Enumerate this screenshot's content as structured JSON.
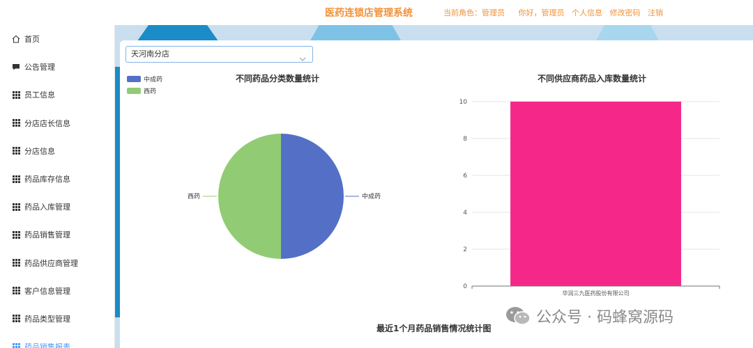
{
  "header": {
    "title": "医药连锁店管理系统",
    "role_label": "当前角色：",
    "role_value": "管理员",
    "greeting": "你好，管理员",
    "links": [
      "个人信息",
      "修改密码",
      "注销"
    ]
  },
  "sidebar": {
    "items": [
      {
        "label": "首页",
        "icon": "home-icon"
      },
      {
        "label": "公告管理",
        "icon": "message-icon"
      },
      {
        "label": "员工信息",
        "icon": "grid-icon"
      },
      {
        "label": "分店店长信息",
        "icon": "grid-icon"
      },
      {
        "label": "分店信息",
        "icon": "grid-icon"
      },
      {
        "label": "药品库存信息",
        "icon": "grid-icon"
      },
      {
        "label": "药品入库管理",
        "icon": "grid-icon"
      },
      {
        "label": "药品销售管理",
        "icon": "grid-icon"
      },
      {
        "label": "药品供应商管理",
        "icon": "grid-icon"
      },
      {
        "label": "客户信息管理",
        "icon": "grid-icon"
      },
      {
        "label": "药品类型管理",
        "icon": "grid-icon"
      },
      {
        "label": "药品销售报表",
        "icon": "grid-icon"
      }
    ]
  },
  "filter": {
    "branch_selected": "天河南分店"
  },
  "colors": {
    "accent_orange": "#f0923a",
    "pie_blue": "#5470c6",
    "pie_green": "#91cc75",
    "bar_pink": "#f5288a"
  },
  "chart_data": [
    {
      "type": "pie",
      "title": "不同药品分类数量统计",
      "legend_position": "top-left",
      "categories": [
        "中成药",
        "西药"
      ],
      "values": [
        1,
        1
      ],
      "colors": [
        "#5470c6",
        "#91cc75"
      ]
    },
    {
      "type": "bar",
      "title": "不同供应商药品入库数量统计",
      "categories": [
        "华润三九医药股份有限公司"
      ],
      "values": [
        10
      ],
      "ylim": [
        0,
        10
      ],
      "yticks": [
        0,
        2,
        4,
        6,
        8,
        10
      ],
      "grid": true,
      "color": "#f5288a"
    },
    {
      "type": "line",
      "title": "最近1个月药品销售情况统计图"
    }
  ],
  "watermark": {
    "text": "公众号 · 码蜂窝源码"
  }
}
